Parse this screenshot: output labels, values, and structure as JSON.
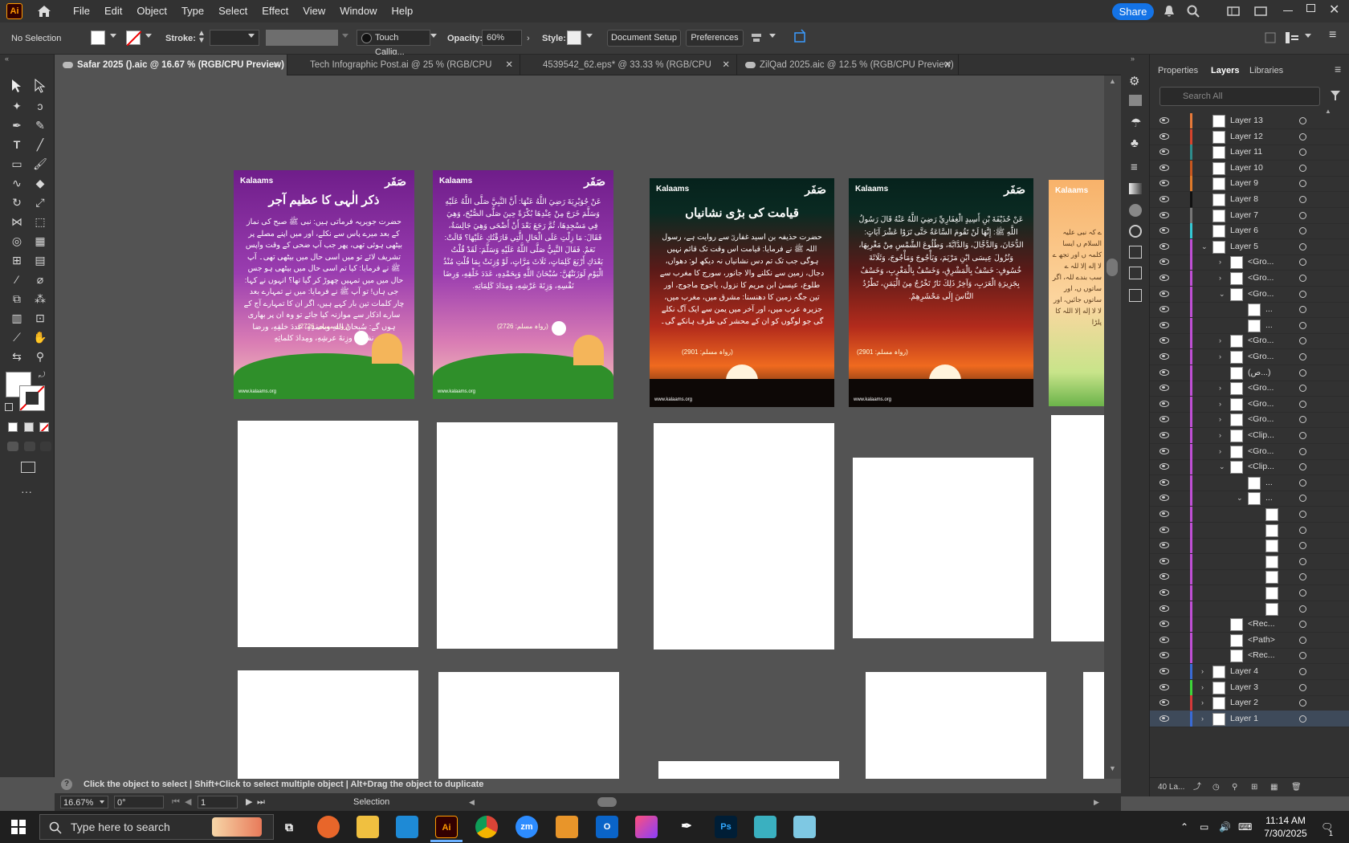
{
  "menubar": {
    "app_logo": "Ai",
    "items": [
      "File",
      "Edit",
      "Object",
      "Type",
      "Select",
      "Effect",
      "View",
      "Window",
      "Help"
    ],
    "share_label": "Share"
  },
  "control_bar": {
    "selection": "No Selection",
    "stroke_label": "Stroke:",
    "brush_label": "Touch Callig...",
    "opacity_label": "Opacity:",
    "opacity_value": "60%",
    "style_label": "Style:",
    "document_setup": "Document Setup",
    "preferences": "Preferences"
  },
  "tabs": [
    {
      "label": "Safar 2025 ().aic @ 16.67 % (RGB/CPU Preview)",
      "active": true
    },
    {
      "label": "Tech Infographic Post.ai @ 25 % (RGB/CPU Preview)",
      "active": false
    },
    {
      "label": "4539542_62.eps* @ 33.33 % (RGB/CPU Preview)",
      "active": false
    },
    {
      "label": "ZilQad 2025.aic @ 12.5 % (RGB/CPU Preview)",
      "active": false
    }
  ],
  "artboards": [
    {
      "brand": "Kalaams",
      "badge": "صَفَر",
      "title": "ذکر الٰہی کا عظیم آجر",
      "body": "حضرت جویریہ فرماتی ہیں: نبی ﷺ صبح کی نماز کے بعد میرے پاس سے نکلے، اور میں اپنے مصلے پر بیٹھی ہوئی تھی، پھر جب آپ ضحی کے وقت واپس تشریف لائے تو میں اسی حال میں بیٹھی تھی۔ آپ ﷺ نے فرمایا: کیا تم اسی حال میں بیٹھی ہو جس حال میں میں تمہیں چھوڑ کر گیا تھا؟ انہوں نے کہا: جی ہاں! تو آپ ﷺ نے فرمایا: میں نے تمہارے بعد چار کلمات تین بار کہے ہیں، اگر ان کا تمہارے آج کے سارے اذکار سے موازنہ کیا جائے تو وہ ان پر بھاری ہوں گے: سُبحانَ اللهِ وبحمدِهِ، عددَ خلقِهِ، ورضا نفسِهِ، وزِنةَ عرشِهِ، ومِدادَ كلماتِهِ",
      "ref": "(رواہ مسلم: 2726)",
      "site": "www.kalaams.org",
      "theme": "purple"
    },
    {
      "brand": "Kalaams",
      "badge": "صَفَر",
      "title": "",
      "body": "عَنْ جُوَيْرِيَةَ رَضِيَ اللَّهُ عَنْهَا: أَنَّ النَّبِيَّ صَلَّى اللَّهُ عَلَيْهِ وَسَلَّمَ خَرَجَ مِنْ عِنْدِهَا بُكْرَةً حِينَ صَلَّى الصُّبْحَ، وَهِيَ فِي مَسْجِدِهَا، ثُمَّ رَجَعَ بَعْدَ أَنْ أَضْحَى وَهِيَ جَالِسَةٌ، فَقَالَ: مَا زِلْتِ عَلَى الْحَالِ الَّتِي فَارَقْتُكِ عَلَيْهَا؟ قَالَتْ: نَعَمْ. فَقَالَ النَّبِيُّ صَلَّى اللَّهُ عَلَيْهِ وَسَلَّمَ: لَقَدْ قُلْتُ بَعْدَكِ أَرْبَعَ كَلِمَاتٍ، ثَلَاثَ مَرَّاتٍ، لَوْ وُزِنَتْ بِمَا قُلْتِ مُنْذُ الْيَوْمِ لَوَزَنَتْهُنَّ: سُبْحَانَ اللَّهِ وَبِحَمْدِهِ، عَدَدَ خَلْقِهِ، وَرِضَا نَفْسِهِ، وَزِنَةَ عَرْشِهِ، وَمِدَادَ كَلِمَاتِهِ.",
      "ref": "(رواہ مسلم: 2726)",
      "site": "www.kalaams.org",
      "theme": "purple"
    },
    {
      "brand": "Kalaams",
      "badge": "صَفَر",
      "title": "قیامت کی بڑی نشانیاں",
      "body": "حضرت حذیفہ بن اسید غفاریؓ سے روایت ہے، رسول اللہ ﷺ نے فرمایا: قیامت اس وقت تک قائم نہیں ہوگی جب تک تم دس نشانیاں نہ دیکھ لو: دھواں، دجال، زمین سے نکلنے والا جانور، سورج کا مغرب سے طلوع، عیسیٰ ابن مریم کا نزول، یاجوج ماجوج، اور تین جگہ زمین کا دھنسنا: مشرق میں، مغرب میں، جزیرہ عرب میں، اور آخر میں یمن سے ایک آگ نکلے گی جو لوگوں کو ان کے محشر کی طرف ہانکے گی۔",
      "ref": "(رواہ مسلم: 2901)",
      "site": "www.kalaams.org",
      "theme": "sunset"
    },
    {
      "brand": "Kalaams",
      "badge": "صَفَر",
      "title": "",
      "body": "عَنْ حُذَيْفَةَ بْنِ أَسِيدٍ الْغِفَارِيِّ رَضِيَ اللَّهُ عَنْهُ قَالَ رَسُولُ اللَّهِ ﷺ: إِنَّهَا لَنْ تَقُومَ السَّاعَةُ حَتَّى تَرَوْا عَشْرَ آيَاتٍ: الدُّخَانَ، وَالدَّجَّالَ، وَالدَّابَّةَ، وَطُلُوعَ الشَّمْسِ مِنْ مَغْرِبِهَا، وَنُزُولَ عِيسَى ابْنِ مَرْيَمَ، وَيَأْجُوجَ وَمَأْجُوجَ، وَثَلَاثَةَ خُسُوفٍ: خَسْفٌ بِالْمَشْرِقِ، وَخَسْفٌ بِالْمَغْرِبِ، وَخَسْفٌ بِجَزِيرَةِ الْعَرَبِ، وَآخِرُ ذَلِكَ نَارٌ تَخْرُجُ مِنَ الْيَمَنِ، تَطْرُدُ النَّاسَ إِلَى مَحْشَرِهِمْ.",
      "ref": "(رواہ مسلم: 2901)",
      "site": "www.kalaams.org",
      "theme": "sunset"
    }
  ],
  "partial_artboard": {
    "brand": "Kalaams",
    "text": "ے کہ نبی علیہ السلام ں ایسا کلمہ ں اور تجھ ے لا إله إلا للہ ے سب بندے للہ، اگر ساتوں ں، اور ساتوں جائیں، اور لا لا إله إلا اللہ کا پلڑا"
  },
  "status": {
    "zoom": "16.67%",
    "rotation": "0°",
    "artboard_num": "1",
    "tool": "Selection",
    "hint": "Click the object to select  |  Shift+Click to select multiple object  |  Alt+Drag the object to duplicate"
  },
  "panel": {
    "tabs": [
      "Properties",
      "Layers",
      "Libraries"
    ],
    "active_tab": "Layers",
    "search_placeholder": "Search All",
    "layer_count": "40 La...",
    "rows": [
      {
        "name": "Layer 13",
        "color": "#e87a3a",
        "depth": 0,
        "arrow": ""
      },
      {
        "name": "Layer 12",
        "color": "#d6452d",
        "depth": 0,
        "arrow": ""
      },
      {
        "name": "Layer 11",
        "color": "#2f8d8d",
        "depth": 0,
        "arrow": ""
      },
      {
        "name": "Layer 10",
        "color": "#c9581f",
        "depth": 0,
        "arrow": ""
      },
      {
        "name": "Layer 9",
        "color": "#e07a2a",
        "depth": 0,
        "arrow": ""
      },
      {
        "name": "Layer 8",
        "color": "#111111",
        "depth": 0,
        "arrow": ""
      },
      {
        "name": "Layer 7",
        "color": "#777777",
        "depth": 0,
        "arrow": ""
      },
      {
        "name": "Layer 6",
        "color": "#35c9d6",
        "depth": 0,
        "arrow": ""
      },
      {
        "name": "Layer 5",
        "color": "#c04fd6",
        "depth": 0,
        "arrow": "down"
      },
      {
        "name": "<Gro...",
        "color": "#c04fd6",
        "depth": 1,
        "arrow": "right"
      },
      {
        "name": "<Gro...",
        "color": "#c04fd6",
        "depth": 1,
        "arrow": "right"
      },
      {
        "name": "<Gro...",
        "color": "#c04fd6",
        "depth": 1,
        "arrow": "down"
      },
      {
        "name": "...",
        "color": "#c04fd6",
        "depth": 2,
        "arrow": ""
      },
      {
        "name": "...",
        "color": "#c04fd6",
        "depth": 2,
        "arrow": ""
      },
      {
        "name": "<Gro...",
        "color": "#c04fd6",
        "depth": 1,
        "arrow": "right"
      },
      {
        "name": "<Gro...",
        "color": "#c04fd6",
        "depth": 1,
        "arrow": "right"
      },
      {
        "name": "(ص...)",
        "color": "#c04fd6",
        "depth": 1,
        "arrow": ""
      },
      {
        "name": "<Gro...",
        "color": "#c04fd6",
        "depth": 1,
        "arrow": "right"
      },
      {
        "name": "<Gro...",
        "color": "#c04fd6",
        "depth": 1,
        "arrow": "right"
      },
      {
        "name": "<Gro...",
        "color": "#c04fd6",
        "depth": 1,
        "arrow": "right"
      },
      {
        "name": "<Clip...",
        "color": "#c04fd6",
        "depth": 1,
        "arrow": "right"
      },
      {
        "name": "<Gro...",
        "color": "#c04fd6",
        "depth": 1,
        "arrow": "right"
      },
      {
        "name": "<Clip...",
        "color": "#c04fd6",
        "depth": 1,
        "arrow": "down"
      },
      {
        "name": "...",
        "color": "#c04fd6",
        "depth": 2,
        "arrow": ""
      },
      {
        "name": "...",
        "color": "#c04fd6",
        "depth": 2,
        "arrow": "down"
      },
      {
        "name": "",
        "color": "#c04fd6",
        "depth": 3,
        "arrow": ""
      },
      {
        "name": "",
        "color": "#c04fd6",
        "depth": 3,
        "arrow": ""
      },
      {
        "name": "",
        "color": "#c04fd6",
        "depth": 3,
        "arrow": ""
      },
      {
        "name": "",
        "color": "#c04fd6",
        "depth": 3,
        "arrow": ""
      },
      {
        "name": "",
        "color": "#c04fd6",
        "depth": 3,
        "arrow": ""
      },
      {
        "name": "",
        "color": "#c04fd6",
        "depth": 3,
        "arrow": ""
      },
      {
        "name": "",
        "color": "#c04fd6",
        "depth": 3,
        "arrow": ""
      },
      {
        "name": "<Rec...",
        "color": "#c04fd6",
        "depth": 1,
        "arrow": ""
      },
      {
        "name": "<Path>",
        "color": "#c04fd6",
        "depth": 1,
        "arrow": ""
      },
      {
        "name": "<Rec...",
        "color": "#c04fd6",
        "depth": 1,
        "arrow": ""
      },
      {
        "name": "Layer 4",
        "color": "#3a6bd6",
        "depth": 0,
        "arrow": "right"
      },
      {
        "name": "Layer 3",
        "color": "#3ed63a",
        "depth": 0,
        "arrow": "right"
      },
      {
        "name": "Layer 2",
        "color": "#d63a3a",
        "depth": 0,
        "arrow": "right"
      },
      {
        "name": "Layer 1",
        "color": "#3a6bd6",
        "depth": 0,
        "arrow": "right",
        "selected": true
      }
    ]
  },
  "taskbar": {
    "search_placeholder": "Type here to search",
    "time": "11:14 AM",
    "date": "7/30/2025",
    "notification_count": "1",
    "apps": [
      "Task View",
      "Firefox",
      "File Explorer",
      "VS Code",
      "Illustrator",
      "Chrome",
      "Zoom",
      "Archive",
      "Outlook",
      "Creative Cloud",
      "Pen",
      "Photoshop",
      "App",
      "Notepad"
    ]
  }
}
